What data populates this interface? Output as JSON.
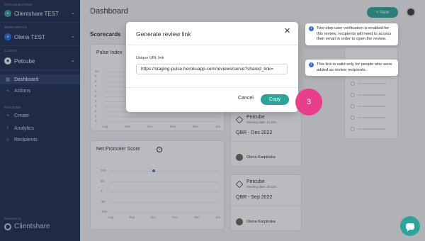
{
  "sidebar": {
    "organisation_label": "ORGANISATION",
    "organisation_name": "Clientshare TEST",
    "workspace_label": "WORKSPACE",
    "workspace_name": "Olena TEST",
    "client_label": "CLIENT",
    "client_name": "Petcube",
    "nav": [
      {
        "label": "Dashboard",
        "icon": "dashboard-icon"
      },
      {
        "label": "Actions",
        "icon": "actions-icon"
      }
    ],
    "reviews_label": "REVIEWS",
    "reviews_nav": [
      {
        "label": "Create",
        "icon": "plus-icon"
      },
      {
        "label": "Analytics",
        "icon": "analytics-icon"
      },
      {
        "label": "Recipients",
        "icon": "recipients-icon"
      }
    ],
    "powered_by": "Powered by",
    "brand": "Clientshare"
  },
  "header": {
    "title": "Dashboard",
    "new_button": "+ New"
  },
  "scorecards": {
    "label": "Scorecards",
    "pulse_index": {
      "title": "Pulse Index",
      "y_ticks": [
        "10",
        "9",
        "8",
        "7",
        "6",
        "5",
        "4",
        "3",
        "2",
        "1",
        "0"
      ],
      "x_ticks": [
        "Aug",
        "Sep",
        "Oct",
        "Nov",
        "Dec",
        "Jan"
      ]
    },
    "nps": {
      "title": "Net Promoter Score",
      "y_ticks": [
        "100",
        "50",
        "0",
        "-50",
        "-100"
      ],
      "x_ticks": [
        "Aug",
        "Sep",
        "Oct",
        "Nov",
        "Dec",
        "Jan"
      ],
      "point": {
        "x": "Oct",
        "y": 100
      }
    }
  },
  "reviews": [
    {
      "company": "Petcube",
      "meeting_date": "Meeting date: 31 Dec",
      "title": "QBR - Dec 2022",
      "person": "Olena Karpinska"
    },
    {
      "company": "Petcube",
      "meeting_date": "Meeting date: 29 Dec",
      "title": "QBR - Sep 2022",
      "person": "Olena Karpinska"
    }
  ],
  "modal": {
    "title": "Generate review link",
    "url_label": "Unique URL link",
    "url_value": "https://staging-pulse.herokuapp.com/reviews/serve?shared_link=",
    "cancel": "Cancel",
    "copy": "Copy"
  },
  "step_badge": "3",
  "tooltips": [
    {
      "text": "Two-step user verification is enabled for this review, recipients will need to access their email in order to open the review."
    },
    {
      "text": "This link is valid only for people who were added as review recipients."
    }
  ],
  "colors": {
    "sidebar_bg": "#1b2b4f",
    "accent": "#2ba59b",
    "badge": "#e83e8c",
    "info": "#3f72c6"
  }
}
